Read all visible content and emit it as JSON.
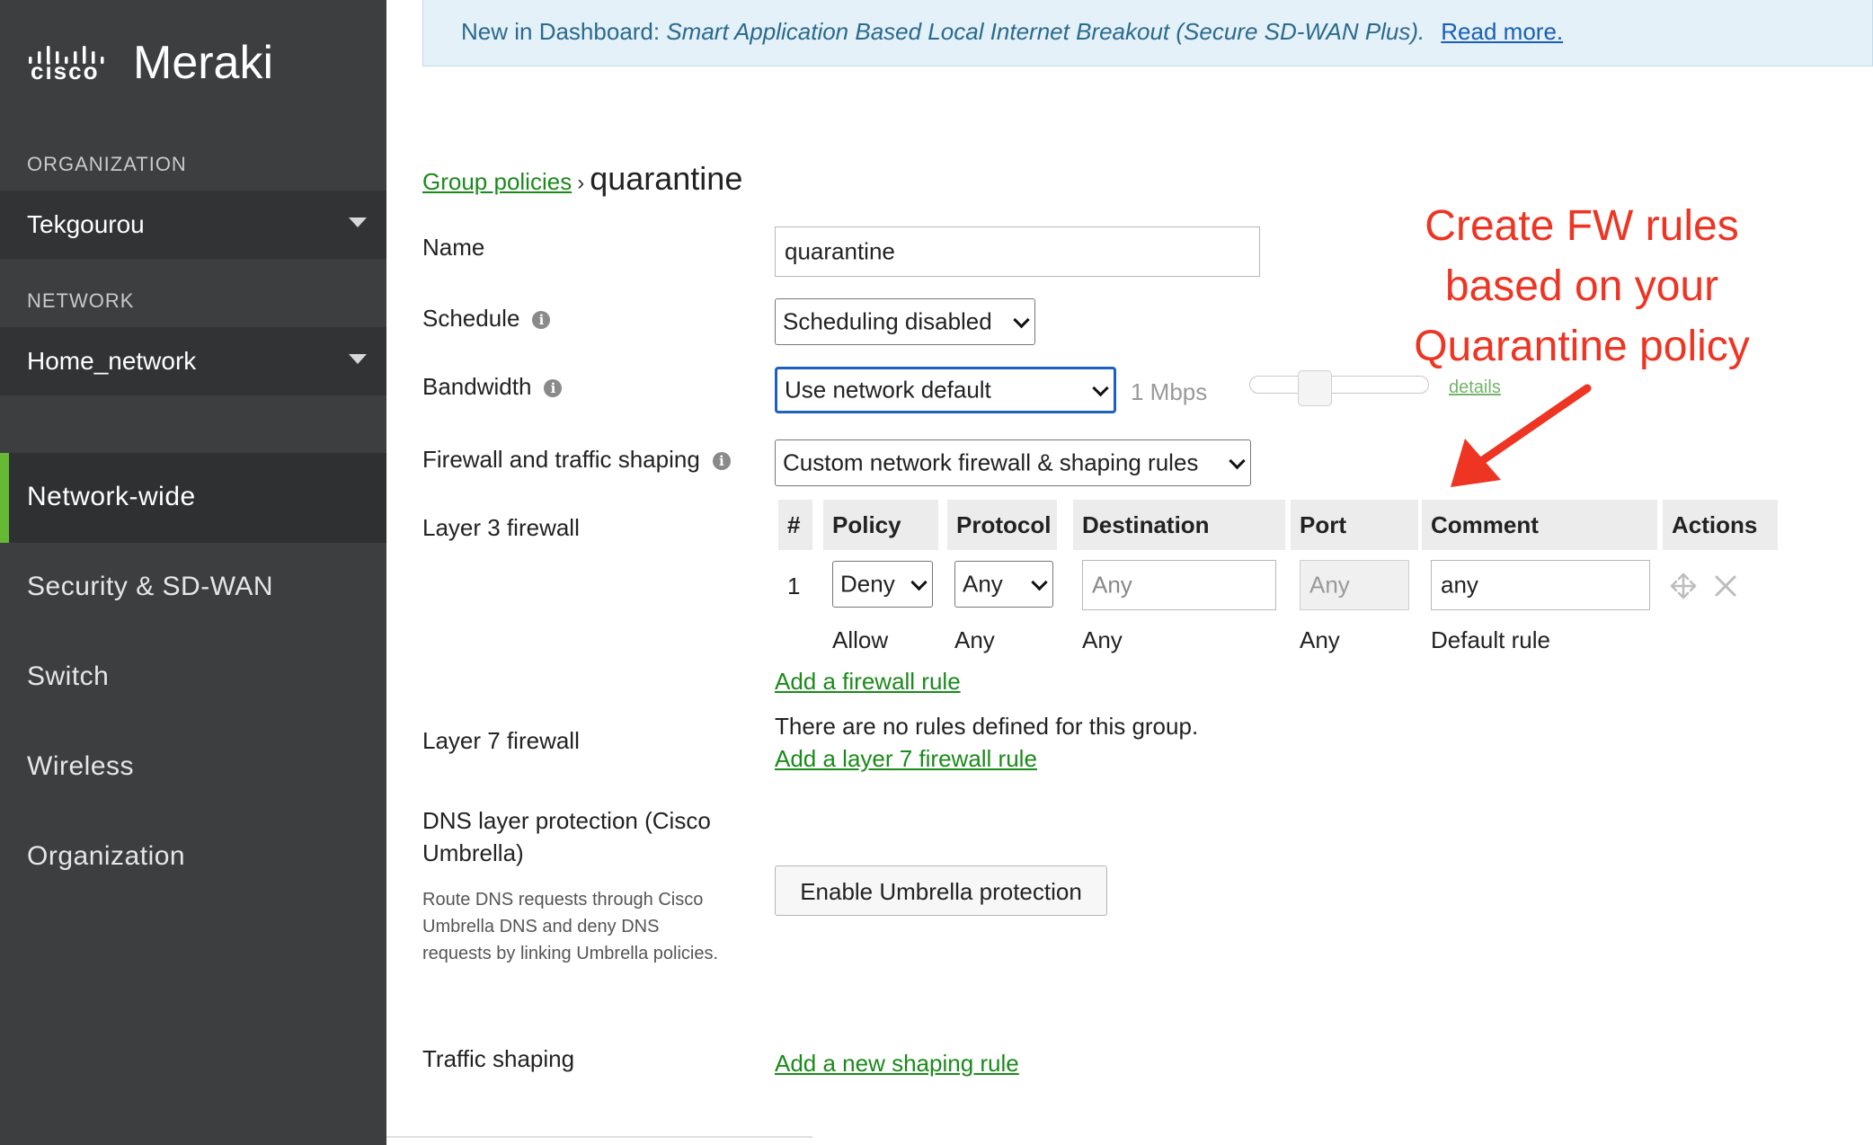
{
  "sidebar": {
    "brand_mark": "cisco",
    "brand_name": "Meraki",
    "org_label": "ORGANIZATION",
    "org_value": "Tekgourou",
    "network_label": "NETWORK",
    "network_value": "Home_network",
    "nav": [
      "Network-wide",
      "Security & SD-WAN",
      "Switch",
      "Wireless",
      "Organization"
    ],
    "active_nav": "Network-wide",
    "accent_color": "#66b935"
  },
  "banner": {
    "prefix": "New in Dashboard: ",
    "feature": "Smart Application Based Local Internet Breakout (Secure SD-WAN Plus).",
    "link": "Read more."
  },
  "breadcrumb": {
    "parent": "Group policies",
    "separator": "›",
    "current": "quarantine"
  },
  "form": {
    "name_label": "Name",
    "name_value": "quarantine",
    "schedule_label": "Schedule",
    "schedule_value": "Scheduling disabled",
    "bandwidth_label": "Bandwidth",
    "bandwidth_value": "Use network default",
    "bandwidth_rate": "1 Mbps",
    "bandwidth_details": "details",
    "firewall_label": "Firewall and traffic shaping",
    "firewall_value": "Custom network firewall & shaping rules",
    "l3_label": "Layer 3 firewall",
    "l7_label": "Layer 7 firewall",
    "l7_empty": "There are no rules defined for this group.",
    "l7_add": "Add a layer 7 firewall rule",
    "dns_label": "DNS layer protection (Cisco Umbrella)",
    "dns_desc": "Route DNS requests through Cisco Umbrella DNS and deny DNS requests by linking Umbrella policies.",
    "umbrella_button": "Enable Umbrella protection",
    "shaping_label": "Traffic shaping",
    "shaping_add": "Add a new shaping rule",
    "info_glyph": "i"
  },
  "l3_table": {
    "headers": [
      "#",
      "Policy",
      "Protocol",
      "Destination",
      "Port",
      "Comment",
      "Actions"
    ],
    "rule": {
      "num": "1",
      "policy": "Deny",
      "protocol": "Any",
      "destination_placeholder": "Any",
      "port_placeholder": "Any",
      "comment": "any"
    },
    "default_rule": {
      "policy": "Allow",
      "protocol": "Any",
      "destination": "Any",
      "port": "Any",
      "comment": "Default rule"
    },
    "add_rule": "Add a firewall rule",
    "action_icons": [
      "move-icon",
      "close-icon"
    ]
  },
  "annotation": {
    "lines": [
      "Create FW rules",
      "based on your",
      "Quarantine policy"
    ],
    "color": "#ee3423"
  }
}
